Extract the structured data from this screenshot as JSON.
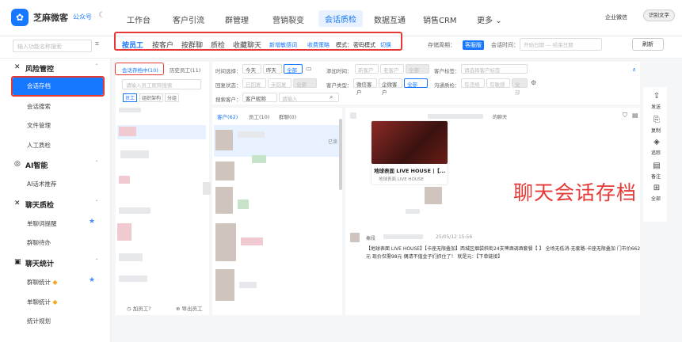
{
  "header": {
    "brand": "芝麻微客",
    "gzh": "公众号",
    "nav": [
      "工作台",
      "客户引流",
      "群管理",
      "营销裂变",
      "会话质检",
      "数据互通",
      "销售CRM",
      "更多"
    ],
    "active_nav": "会话质检",
    "more_arrow": "⌄",
    "enterprise_badge": "企业微信",
    "translate_btn": "识别文字"
  },
  "subbar": {
    "search_placeholder": "输入功能名称搜索",
    "tabs": [
      "按员工",
      "按客户",
      "按群聊",
      "质检",
      "收藏聊天"
    ],
    "active_tab": "按员工",
    "links": [
      "新增敏感词",
      "收费策略"
    ],
    "mode_label": "模式：",
    "mode_value": "密码模式",
    "mode_switch": "切换",
    "storage_label": "存储周期：",
    "storage_badge": "客服版",
    "time_label": "会话时间：",
    "start_date": "开始日期",
    "end_date": "结束日期",
    "refresh": "刷新"
  },
  "sidebar": {
    "groups": [
      {
        "title": "风险管控",
        "icon": "✕",
        "items": [
          "会话存档",
          "会话搜索",
          "文件管理",
          "人工质检"
        ]
      },
      {
        "title": "AI智能",
        "icon": "◎",
        "items": [
          "AI话术推荐"
        ]
      },
      {
        "title": "聊天质检",
        "icon": "✕",
        "items": [
          "单聊词提醒",
          "群聊待办"
        ]
      },
      {
        "title": "聊天统计",
        "icon": "▣",
        "items": [
          "群聊统计",
          "单聊统计",
          "统计规划"
        ]
      }
    ],
    "active": "会话存档"
  },
  "left_panel": {
    "tabs": [
      "会话存档中(10)",
      "历史员工(11)"
    ],
    "search_placeholder": "请输入员工昵称搜索",
    "filters": [
      "员工",
      "组织架构",
      "分组"
    ],
    "footer": [
      "加员工?",
      "导出员工"
    ]
  },
  "filters": {
    "time_label": "时间选择：",
    "time_opts": [
      "今天",
      "昨天",
      "全部"
    ],
    "add_time_label": "添加时间：",
    "add_opts": [
      "新客户",
      "老客户",
      "全部"
    ],
    "customer_tag_label": "客户标签：",
    "tag_placeholder": "请选择客户标签",
    "status_label": "回复状态：",
    "status_opts": [
      "已回复",
      "未回复",
      "全部"
    ],
    "type_label": "客户类型：",
    "type_opts": [
      "微信客户",
      "企微客户",
      "全部"
    ],
    "check_label": "沟通质检：",
    "check_opts": [
      "有违规",
      "有敏感",
      "全部"
    ],
    "search_label": "搜索客户：",
    "search_select": "客户昵称",
    "search_placeholder": "请输入"
  },
  "middle": {
    "tabs": [
      "客户(62)",
      "员工(10)",
      "群聊(0)"
    ],
    "read_label": "已读"
  },
  "chat": {
    "header_time": "的聊天",
    "card_title": "地球表面 LIVE HOUSE |【...",
    "card_sub": "地球表面 LIVE HOUSE",
    "sender": "秦段",
    "msg_time": "25/05/12 15:56",
    "msg_body": "【地球表面 LIVE HOUSE】【卡座无限叠加】西城区烟袋斜街24支啤酒调酒套餐【 】 全场无低消-无套路-卡座无限叠加 门市价662元 现价仅需98元 偶请不值金子们抓住了！ 就是元：【下单链接】"
  },
  "watermark": "聊天会话存档",
  "right_tools": [
    {
      "icon": "⇪",
      "label": "发送"
    },
    {
      "icon": "⎘",
      "label": "复制"
    },
    {
      "icon": "◈",
      "label": "追踪"
    },
    {
      "icon": "▤",
      "label": "备注"
    },
    {
      "icon": "⊞",
      "label": "全部"
    }
  ],
  "colors": {
    "accent": "#1677ff",
    "red": "#e53935"
  }
}
